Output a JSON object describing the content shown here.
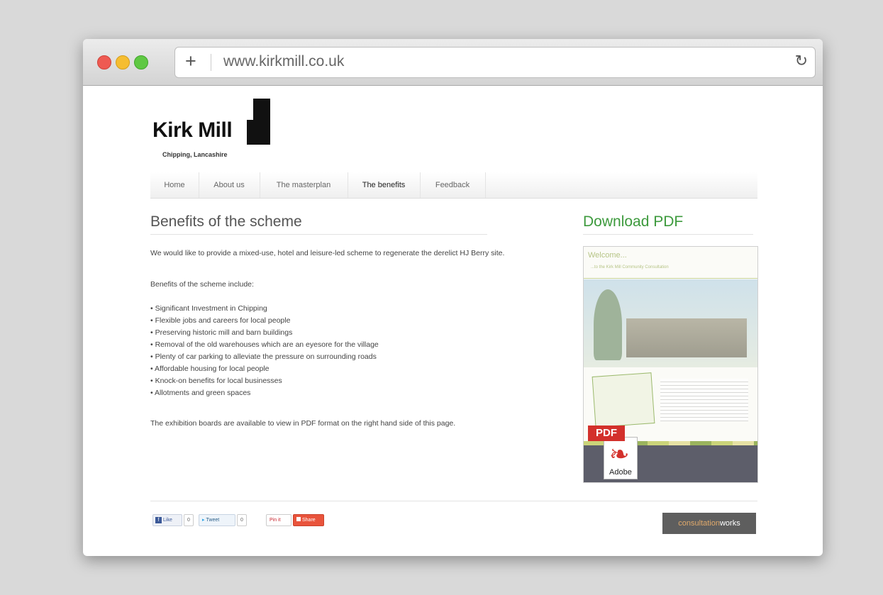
{
  "browser": {
    "url": "www.kirkmill.co.uk",
    "new_tab_icon": "+",
    "reload_icon": "↻"
  },
  "site": {
    "logo_title": "Kirk Mill",
    "logo_subtitle": "Chipping, Lancashire"
  },
  "nav": {
    "items": [
      "Home",
      "About us",
      "The masterplan",
      "The benefits",
      "Feedback"
    ],
    "active": "The benefits"
  },
  "main": {
    "heading": "Benefits of the scheme",
    "intro": "We would like to provide a mixed-use, hotel and leisure-led scheme to regenerate the derelict HJ Berry site.",
    "lead": "Benefits of the scheme include:",
    "benefits": [
      "• Significant Investment in Chipping",
      "• Flexible jobs and careers for local people",
      "• Preserving historic mill and barn buildings",
      "• Removal of the old warehouses which are an eyesore for the village",
      "• Plenty of car parking to alleviate the pressure on surrounding roads",
      "• Affordable housing for local people",
      "• Knock-on benefits for local businesses",
      "• Allotments and green spaces"
    ],
    "outro": "The exhibition boards are available to view in PDF format on the right hand side of this page."
  },
  "sidebar": {
    "heading": "Download PDF",
    "thumb_title": "Welcome...",
    "thumb_subtitle": "...to the Kirk Mill Community Consultation",
    "pdf_label": "PDF",
    "adobe_label": "Adobe"
  },
  "footer": {
    "like_label": "Like",
    "like_count": "0",
    "tweet_label": "Tweet",
    "tweet_count": "0",
    "pin_label": "Pin it",
    "share_label": "Share",
    "brand_part1": "consultation",
    "brand_part2": "works"
  },
  "colors": {
    "accent_green": "#3d9a3d",
    "pdf_red": "#d3302b"
  }
}
